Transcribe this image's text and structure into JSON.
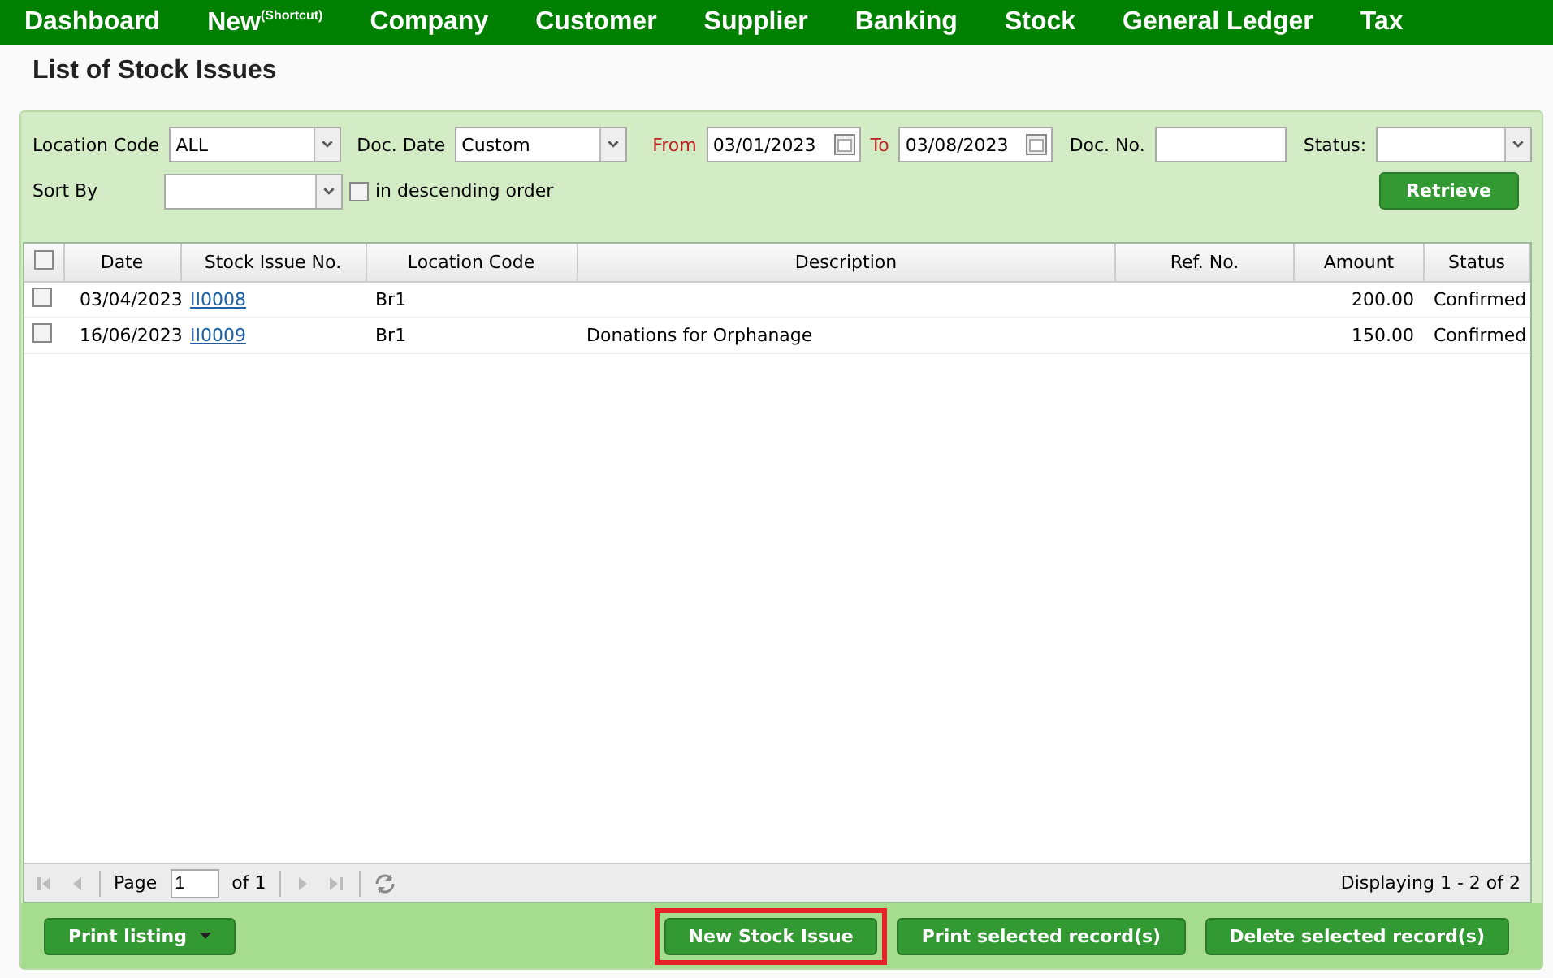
{
  "nav": [
    {
      "label": "Dashboard"
    },
    {
      "label": "New",
      "sup": "(Shortcut)"
    },
    {
      "label": "Company"
    },
    {
      "label": "Customer"
    },
    {
      "label": "Supplier"
    },
    {
      "label": "Banking"
    },
    {
      "label": "Stock"
    },
    {
      "label": "General Ledger"
    },
    {
      "label": "Tax"
    }
  ],
  "title": "List of Stock Issues",
  "filters": {
    "location_code": {
      "label": "Location Code",
      "value": "ALL"
    },
    "doc_date": {
      "label": "Doc. Date",
      "value": "Custom"
    },
    "from": {
      "label": "From",
      "value": "03/01/2023"
    },
    "to": {
      "label": "To",
      "value": "03/08/2023"
    },
    "doc_no": {
      "label": "Doc. No."
    },
    "status": {
      "label": "Status:"
    },
    "sort_by": {
      "label": "Sort By"
    },
    "descending": {
      "label": "in descending order",
      "checked": false
    },
    "retrieve": "Retrieve"
  },
  "table": {
    "columns": [
      "Date",
      "Stock Issue No.",
      "Location Code",
      "Description",
      "Ref. No.",
      "Amount",
      "Status"
    ],
    "all_checked": false,
    "rows": [
      {
        "checked": false,
        "date": "03/04/2023",
        "no": "II0008",
        "location": "Br1",
        "description": "",
        "ref": "",
        "amount": "200.00",
        "status": "Confirmed"
      },
      {
        "checked": false,
        "date": "16/06/2023",
        "no": "II0009",
        "location": "Br1",
        "description": "Donations for Orphanage",
        "ref": "",
        "amount": "150.00",
        "status": "Confirmed"
      }
    ]
  },
  "pager": {
    "page_label": "Page",
    "page": "1",
    "of": "of 1",
    "displaying": "Displaying 1 - 2 of 2"
  },
  "buttons": [
    {
      "label": "Print listing",
      "kind": "split",
      "highlighted": false
    },
    {
      "label": "New Stock Issue",
      "kind": "plain",
      "highlighted": true
    },
    {
      "label": "Print selected record(s)",
      "kind": "plain",
      "highlighted": false
    },
    {
      "label": "Delete selected record(s)",
      "kind": "plain",
      "highlighted": false
    }
  ]
}
